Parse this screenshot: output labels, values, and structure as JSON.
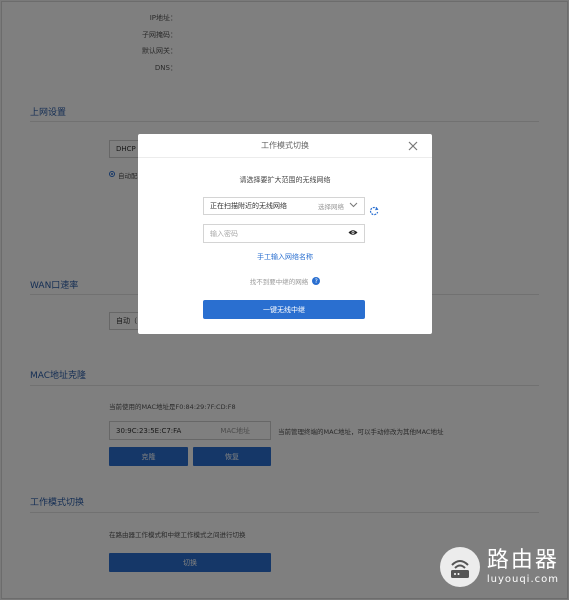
{
  "info_labels": [
    "IP地址：",
    "子网掩码：",
    "默认网关：",
    "DNS："
  ],
  "sections": {
    "internet": "上网设置",
    "wan_rate": "WAN口速率",
    "mac_clone": "MAC地址克隆",
    "work_mode": "工作模式切换"
  },
  "internet": {
    "type_value": "DHCP",
    "radio_label": "自动配"
  },
  "wan_rate": {
    "value": "自动（"
  },
  "mac": {
    "current_text": "当前使用的MAC地址是F0:84:29:7F:CD:F8",
    "input_value": "30:9C:23:5E:C7:FA",
    "input_suffix": "MAC地址",
    "hint": "当前管理终端的MAC地址，可以手动修改为其他MAC地址",
    "clone_btn": "克隆",
    "restore_btn": "恢复"
  },
  "work_mode": {
    "desc": "在路由器工作模式和中继工作模式之间进行切换",
    "switch_btn": "切换"
  },
  "modal": {
    "title": "工作模式切换",
    "subtitle": "请选择要扩大范围的无线网络",
    "scan_text": "正在扫描附近的无线网络",
    "select_placeholder": "选择网络",
    "password_placeholder": "输入密码",
    "manual_link": "手工输入网络名称",
    "cant_find": "找不到要中继的网络",
    "help_glyph": "?",
    "primary_btn": "一键无线中继"
  },
  "watermark": {
    "big": "路由器",
    "small": "luyouqi.com"
  },
  "colors": {
    "accent": "#2a6fd0",
    "section_title": "#2a5da8"
  }
}
